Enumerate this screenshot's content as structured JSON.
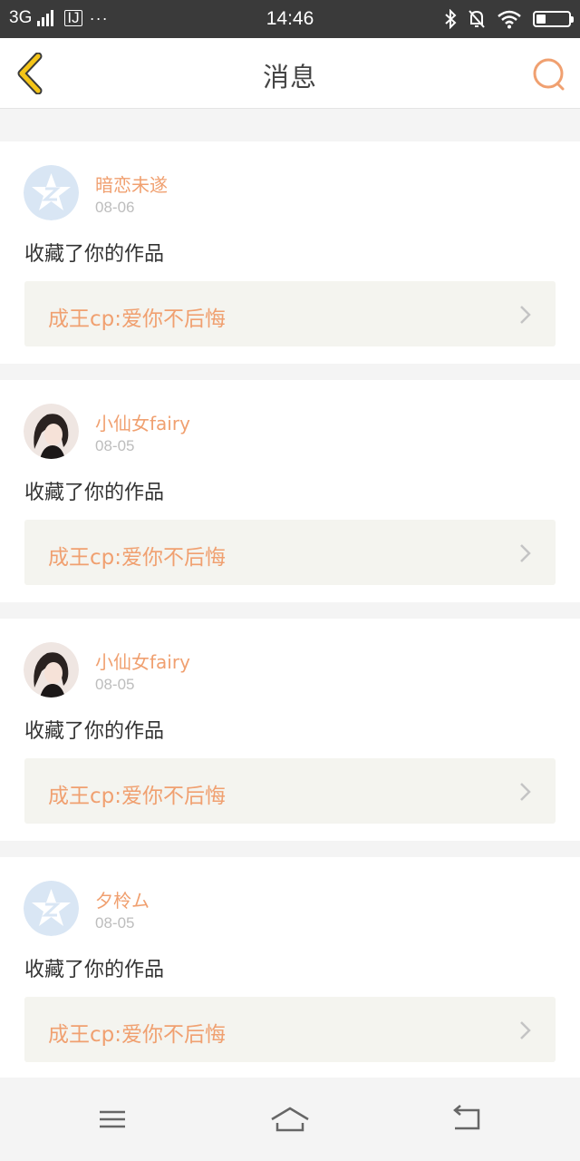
{
  "status_bar": {
    "network": "3G",
    "sim": "IJ",
    "dots": "···",
    "time": "14:46",
    "battery_level": 0.3
  },
  "header": {
    "title": "消息",
    "accent_color": "#f0a070"
  },
  "notifications": [
    {
      "user": "暗恋未遂",
      "date": "08-06",
      "action": "收藏了你的作品",
      "work": "成王cp:爱你不后悔",
      "avatar": "qq-default-avatar"
    },
    {
      "user": "小仙女fairy",
      "date": "08-05",
      "action": "收藏了你的作品",
      "work": "成王cp:爱你不后悔",
      "avatar": "girl-photo-avatar"
    },
    {
      "user": "小仙女fairy",
      "date": "08-05",
      "action": "收藏了你的作品",
      "work": "成王cp:爱你不后悔",
      "avatar": "girl-photo-avatar"
    },
    {
      "user": "夕柃ム",
      "date": "08-05",
      "action": "收藏了你的作品",
      "work": "成王cp:爱你不后悔",
      "avatar": "qq-default-avatar"
    }
  ],
  "system_nav": {
    "menu_icon": "menu-icon",
    "home_icon": "home-icon",
    "back_icon": "return-icon"
  }
}
